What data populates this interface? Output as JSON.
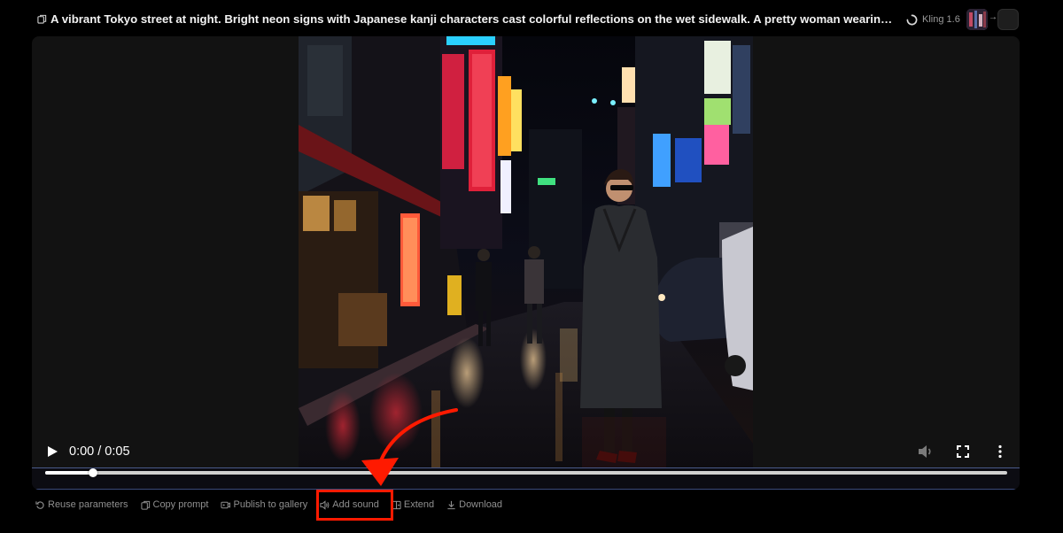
{
  "header": {
    "title": "A vibrant Tokyo street at night. Bright neon signs with Japanese kanji characters cast colorful reflections on the wet sidewalk. A pretty woman wearing sunglasses, a bl...",
    "model_label": "Kling 1.6",
    "arrow_glyph": "→"
  },
  "player": {
    "time_display": "0:00 / 0:05",
    "progress_fraction": 0.05
  },
  "actions": [
    {
      "label": "Reuse parameters",
      "icon": "reuse-icon"
    },
    {
      "label": "Copy prompt",
      "icon": "copy-icon"
    },
    {
      "label": "Publish to gallery",
      "icon": "publish-icon"
    },
    {
      "label": "Add sound",
      "icon": "speaker-icon"
    },
    {
      "label": "Extend",
      "icon": "extend-icon"
    },
    {
      "label": "Download",
      "icon": "download-icon"
    }
  ],
  "colors": {
    "highlight": "#ff1a00",
    "accent_line": "#4a5a8a",
    "muted_text": "#8f8f8f"
  }
}
